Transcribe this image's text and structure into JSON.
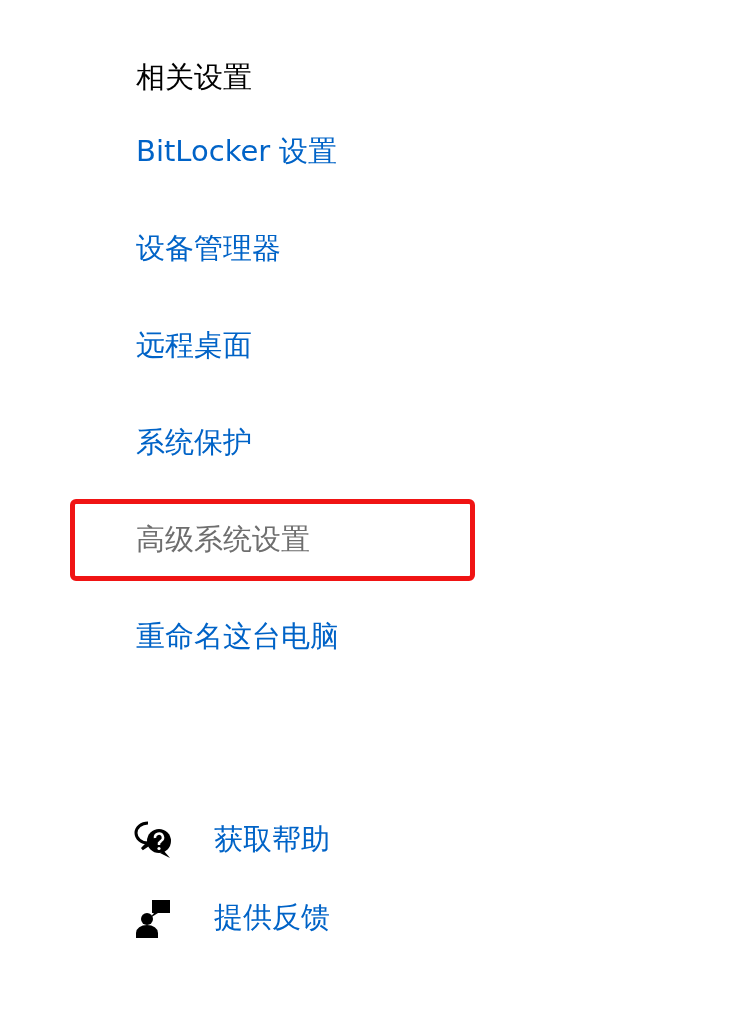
{
  "related_settings": {
    "title": "相关设置",
    "links": [
      {
        "label": "BitLocker 设置",
        "highlighted": false
      },
      {
        "label": "设备管理器",
        "highlighted": false
      },
      {
        "label": "远程桌面",
        "highlighted": false
      },
      {
        "label": "系统保护",
        "highlighted": false
      },
      {
        "label": "高级系统设置",
        "highlighted": true
      },
      {
        "label": "重命名这台电脑",
        "highlighted": false
      }
    ]
  },
  "help_links": [
    {
      "kind": "help",
      "label": "获取帮助"
    },
    {
      "kind": "feedback",
      "label": "提供反馈"
    }
  ]
}
